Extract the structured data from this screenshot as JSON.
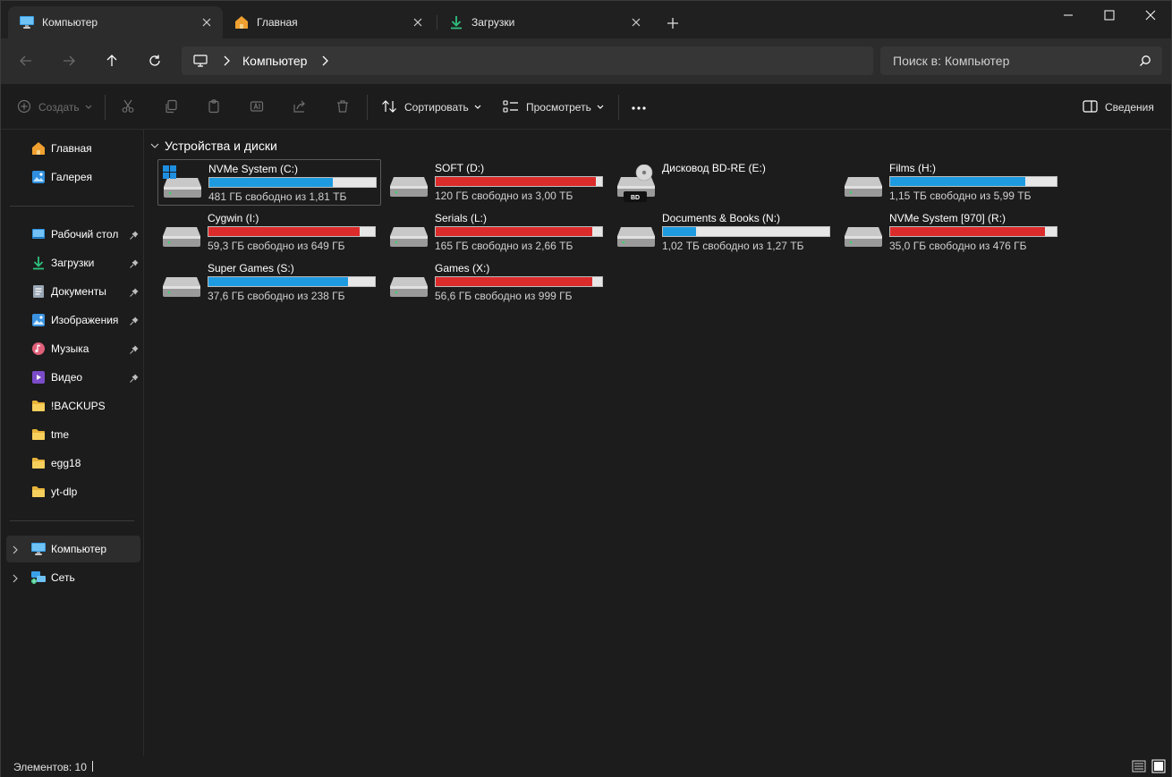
{
  "tabs": [
    {
      "label": "Компьютер",
      "icon": "monitor-icon",
      "active": true
    },
    {
      "label": "Главная",
      "icon": "home-icon",
      "active": false
    },
    {
      "label": "Загрузки",
      "icon": "download-icon",
      "active": false
    }
  ],
  "address": {
    "crumb": "Компьютер",
    "search_placeholder": "Поиск в: Компьютер"
  },
  "toolbar": {
    "create_label": "Создать",
    "sort_label": "Сортировать",
    "view_label": "Просмотреть",
    "details_label": "Сведения"
  },
  "sidebar": {
    "top": [
      {
        "label": "Главная",
        "icon": "home-icon"
      },
      {
        "label": "Галерея",
        "icon": "gallery-icon"
      }
    ],
    "pinned": [
      {
        "label": "Рабочий стол",
        "icon": "desktop-icon",
        "pinned": true
      },
      {
        "label": "Загрузки",
        "icon": "download-icon",
        "pinned": true
      },
      {
        "label": "Документы",
        "icon": "documents-icon",
        "pinned": true
      },
      {
        "label": "Изображения",
        "icon": "pictures-icon",
        "pinned": true
      },
      {
        "label": "Музыка",
        "icon": "music-icon",
        "pinned": true
      },
      {
        "label": "Видео",
        "icon": "video-icon",
        "pinned": true
      },
      {
        "label": "!BACKUPS",
        "icon": "folder-icon",
        "pinned": false
      },
      {
        "label": "tme",
        "icon": "folder-icon",
        "pinned": false
      },
      {
        "label": "egg18",
        "icon": "folder-icon",
        "pinned": false
      },
      {
        "label": "yt-dlp",
        "icon": "folder-icon",
        "pinned": false
      }
    ],
    "bottom": [
      {
        "label": "Компьютер",
        "icon": "monitor-icon",
        "selected": true
      },
      {
        "label": "Сеть",
        "icon": "network-icon",
        "selected": false
      }
    ]
  },
  "content": {
    "group_title": "Устройства и диски",
    "drives": [
      {
        "name": "NVMe System (C:)",
        "info": "481 ГБ свободно из 1,81 ТБ",
        "used": 0.74,
        "color": "#1e9be0",
        "icon": "windows-drive-icon",
        "selected": true
      },
      {
        "name": "SOFT (D:)",
        "info": "120 ГБ свободно из 3,00 ТБ",
        "used": 0.96,
        "color": "#db2b2b",
        "icon": "hard-drive-icon"
      },
      {
        "name": "Дисковод BD-RE (E:)",
        "info": "",
        "used": null,
        "color": "",
        "icon": "bd-drive-icon"
      },
      {
        "name": "Films (H:)",
        "info": "1,15 ТБ свободно из 5,99 ТБ",
        "used": 0.81,
        "color": "#1e9be0",
        "icon": "hard-drive-icon"
      },
      {
        "name": "Cygwin (I:)",
        "info": "59,3 ГБ свободно из 649 ГБ",
        "used": 0.91,
        "color": "#db2b2b",
        "icon": "hard-drive-icon"
      },
      {
        "name": "Serials (L:)",
        "info": "165 ГБ свободно из 2,66 ТБ",
        "used": 0.94,
        "color": "#db2b2b",
        "icon": "hard-drive-icon"
      },
      {
        "name": "Documents & Books (N:)",
        "info": "1,02 ТБ свободно из 1,27 ТБ",
        "used": 0.2,
        "color": "#1e9be0",
        "icon": "hard-drive-icon"
      },
      {
        "name": "NVMe System [970] (R:)",
        "info": "35,0 ГБ свободно из 476 ГБ",
        "used": 0.93,
        "color": "#db2b2b",
        "icon": "hard-drive-icon"
      },
      {
        "name": "Super Games (S:)",
        "info": "37,6 ГБ свободно из 238 ГБ",
        "used": 0.84,
        "color": "#1e9be0",
        "icon": "hard-drive-icon"
      },
      {
        "name": "Games (X:)",
        "info": "56,6 ГБ свободно из 999 ГБ",
        "used": 0.94,
        "color": "#db2b2b",
        "icon": "hard-drive-icon"
      }
    ]
  },
  "status": {
    "count": "Элементов: 10"
  }
}
